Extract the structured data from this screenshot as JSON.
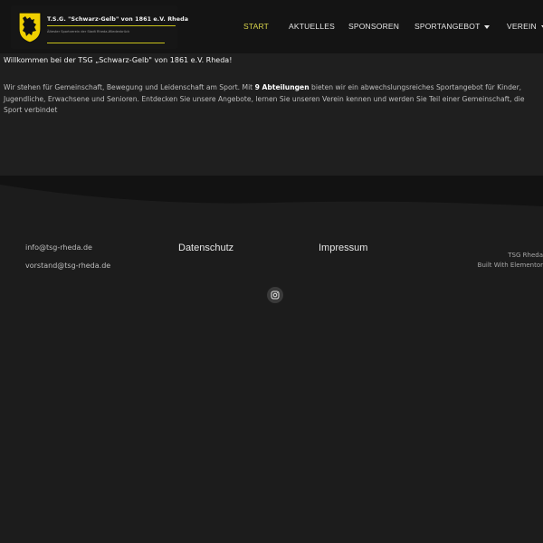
{
  "header": {
    "logo": {
      "title": "T.S.G. \"Schwarz-Gelb\" von 1861 e.V. Rheda",
      "subtitle": "Ältester Sportverein der Stadt Rheda-Wiedenbrück"
    },
    "nav": [
      {
        "label": "START",
        "active": true
      },
      {
        "label": "AKTUELLES"
      },
      {
        "label": "SPONSOREN"
      },
      {
        "label": "SPORTANGEBOT",
        "dropdown": true
      },
      {
        "label": "VEREIN",
        "dropdown": true
      }
    ]
  },
  "main": {
    "welcome": "Willkommen bei der TSG „Schwarz-Gelb\" von 1861 e.V. Rheda!",
    "intro_before": "Wir stehen für Gemeinschaft, Bewegung und Leidenschaft am Sport. Mit ",
    "intro_bold": "9 Abteilungen",
    "intro_after": " bieten wir ein abwechslungsreiches Sportangebot für Kinder, Jugendliche, Erwachsene und Senioren. Entdecken Sie unsere Angebote, lernen Sie unseren Verein kennen und werden Sie Teil einer Gemeinschaft, die Sport verbindet"
  },
  "footer": {
    "emails": [
      "info@tsg-rheda.de",
      "vorstand@tsg-rheda.de"
    ],
    "privacy": "Datenschutz",
    "imprint": "Impressum",
    "credit_name": "TSG Rheda",
    "credit_built": "Built With Elementor",
    "social_icon": "instagram-icon"
  },
  "colors": {
    "accent": "#d9d44b",
    "crest_yellow": "#f0d000",
    "background": "#1c1c1c",
    "header_bg": "#141414"
  }
}
